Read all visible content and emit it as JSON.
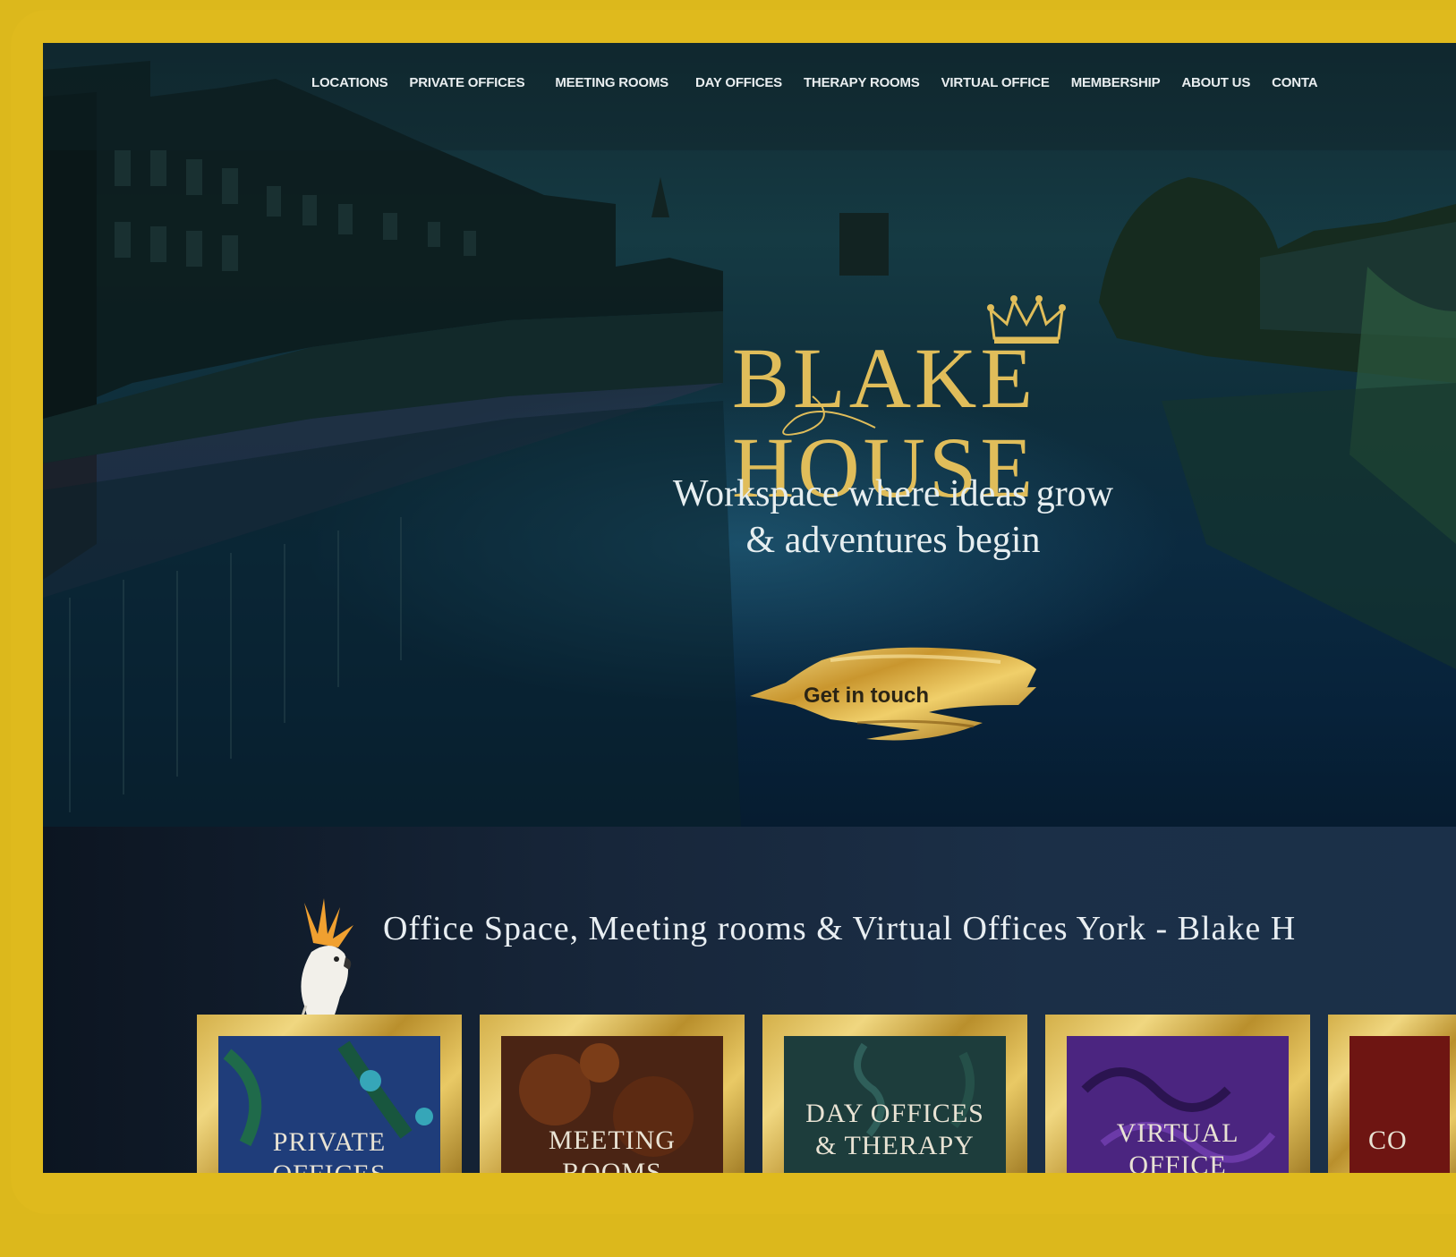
{
  "nav": {
    "items": [
      "LOCATIONS",
      "PRIVATE OFFICES",
      "MEETING ROOMS",
      "DAY OFFICES",
      "THERAPY ROOMS",
      "VIRTUAL OFFICE",
      "MEMBERSHIP",
      "ABOUT US",
      "CONTA"
    ]
  },
  "hero": {
    "logo_text": "BLAKE HOUSE",
    "tagline_line1": "Workspace where ideas grow",
    "tagline_line2": "& adventures begin",
    "cta_label": "Get in touch"
  },
  "section": {
    "heading": "Office Space, Meeting rooms & Virtual Offices York - Blake H"
  },
  "cards": [
    {
      "line1": "PRIVATE",
      "line2": "OFFICES",
      "color": "#1f3d7a"
    },
    {
      "line1": "MEETING",
      "line2": "ROOMS",
      "color": "#4a2414"
    },
    {
      "line1": "DAY OFFICES",
      "line2": "& THERAPY",
      "color": "#1d3d3c"
    },
    {
      "line1": "VIRTUAL",
      "line2": "OFFICE",
      "color": "#4b2580"
    },
    {
      "line1": "CO",
      "line2": "",
      "color": "#6e1512"
    }
  ],
  "colors": {
    "frame": "#dfba1d",
    "gold": "#e0bd5a",
    "hero_dark": "#0b2a40"
  }
}
